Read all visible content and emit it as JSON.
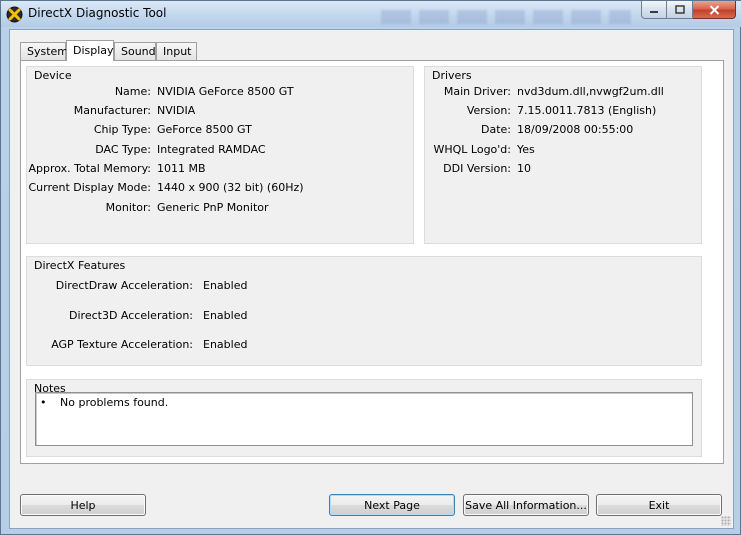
{
  "window": {
    "title": "DirectX Diagnostic Tool",
    "icon": "directx-x-icon",
    "caption_buttons": [
      "minimize-icon",
      "maximize-icon",
      "close-icon"
    ]
  },
  "tabs": [
    {
      "label": "System",
      "active": false
    },
    {
      "label": "Display",
      "active": true
    },
    {
      "label": "Sound",
      "active": false
    },
    {
      "label": "Input",
      "active": false
    }
  ],
  "device": {
    "title": "Device",
    "rows": [
      {
        "label": "Name:",
        "value": "NVIDIA GeForce 8500 GT"
      },
      {
        "label": "Manufacturer:",
        "value": "NVIDIA"
      },
      {
        "label": "Chip Type:",
        "value": "GeForce 8500 GT"
      },
      {
        "label": "DAC Type:",
        "value": "Integrated RAMDAC"
      },
      {
        "label": "Approx. Total Memory:",
        "value": "1011 MB"
      },
      {
        "label": "Current Display Mode:",
        "value": "1440 x 900 (32 bit) (60Hz)"
      },
      {
        "label": "Monitor:",
        "value": "Generic PnP Monitor"
      }
    ]
  },
  "drivers": {
    "title": "Drivers",
    "rows": [
      {
        "label": "Main Driver:",
        "value": "nvd3dum.dll,nvwgf2um.dll"
      },
      {
        "label": "Version:",
        "value": "7.15.0011.7813 (English)"
      },
      {
        "label": "Date:",
        "value": "18/09/2008 00:55:00"
      },
      {
        "label": "WHQL Logo'd:",
        "value": "Yes"
      },
      {
        "label": "DDI Version:",
        "value": "10"
      }
    ]
  },
  "features": {
    "title": "DirectX Features",
    "rows": [
      {
        "label": "DirectDraw Acceleration:",
        "value": "Enabled"
      },
      {
        "label": "Direct3D Acceleration:",
        "value": "Enabled"
      },
      {
        "label": "AGP Texture Acceleration:",
        "value": "Enabled"
      }
    ]
  },
  "notes": {
    "title": "Notes",
    "bullet": "•",
    "items": [
      "No problems found."
    ]
  },
  "buttons": {
    "help": "Help",
    "next_page": "Next Page",
    "save_all": "Save All Information...",
    "exit": "Exit"
  },
  "colors": {
    "accent_default_button": "#3c7fb1",
    "close_button": "#c4402a"
  }
}
